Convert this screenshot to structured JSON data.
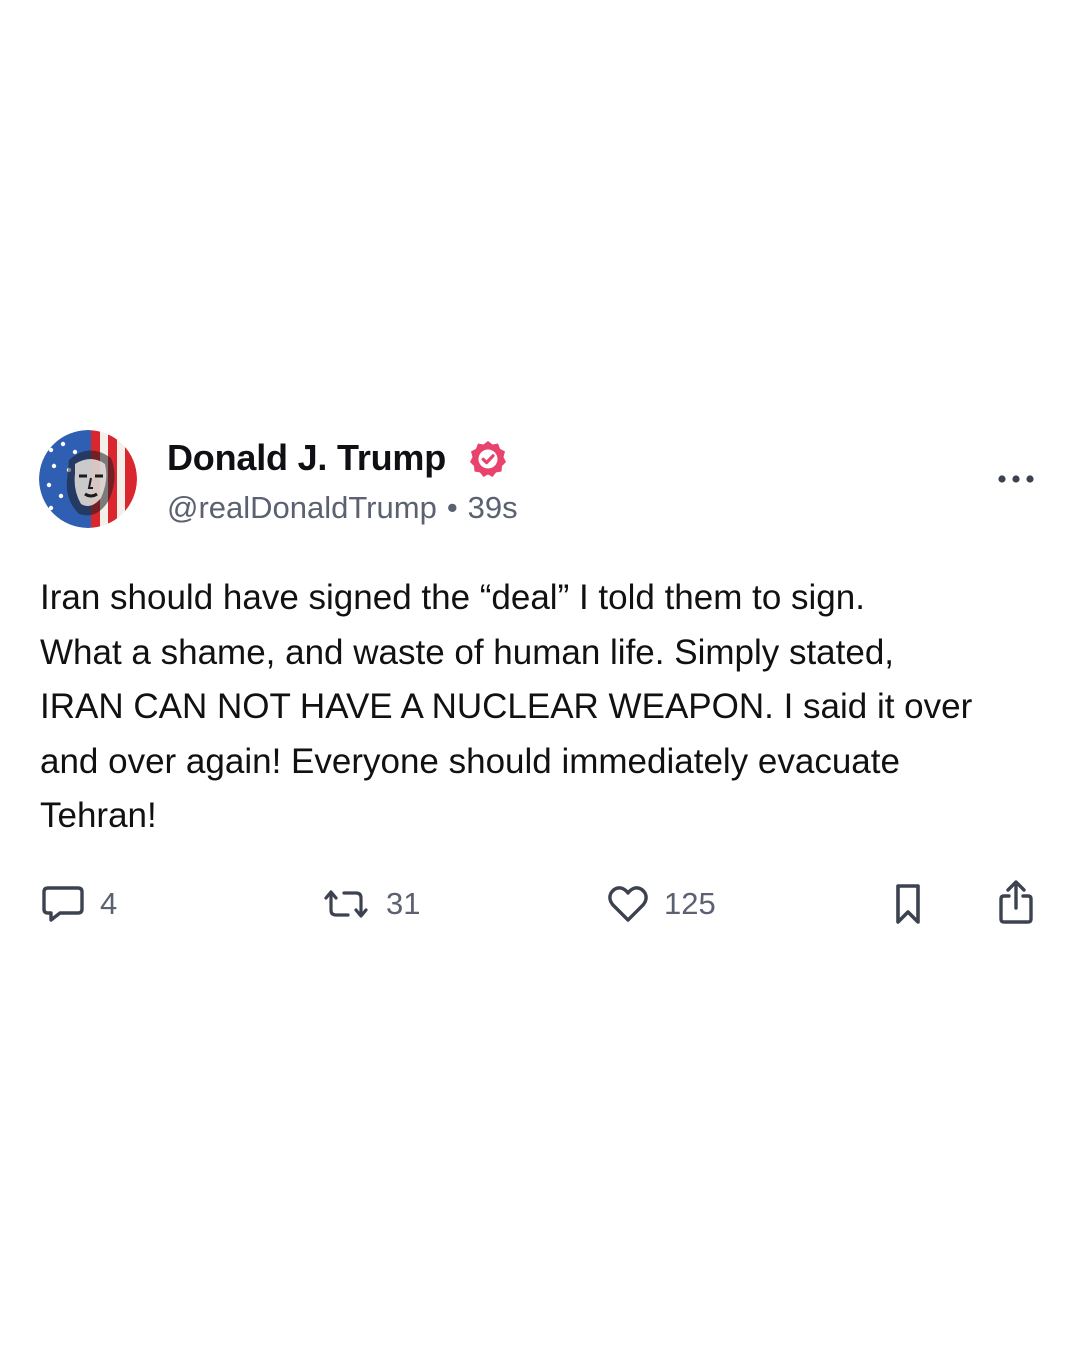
{
  "post": {
    "author": {
      "display_name": "Donald J. Trump",
      "handle": "@realDonaldTrump",
      "separator": "•",
      "timestamp": "39s",
      "verified": true,
      "avatar_icon": "user-avatar-flag-portrait"
    },
    "text_lines": [
      "Iran should have signed the “deal” I told them to sign.",
      "What a shame, and waste of human life. Simply stated,",
      "IRAN CAN NOT HAVE A NUCLEAR WEAPON. I said it over",
      "and over again! Everyone should immediately evacuate",
      "Tehran!"
    ],
    "actions": {
      "reply": {
        "icon": "comment-icon",
        "count": "4"
      },
      "repost": {
        "icon": "repost-icon",
        "count": "31"
      },
      "like": {
        "icon": "heart-icon",
        "count": "125"
      },
      "bookmark": {
        "icon": "bookmark-icon"
      },
      "share": {
        "icon": "share-icon"
      }
    },
    "more_icon": "more-horizontal-icon"
  },
  "colors": {
    "background": "#ffffff",
    "text": "#111111",
    "secondary_text": "#5b6170",
    "verified_badge": "#e8436c",
    "icon": "#3d4250"
  }
}
